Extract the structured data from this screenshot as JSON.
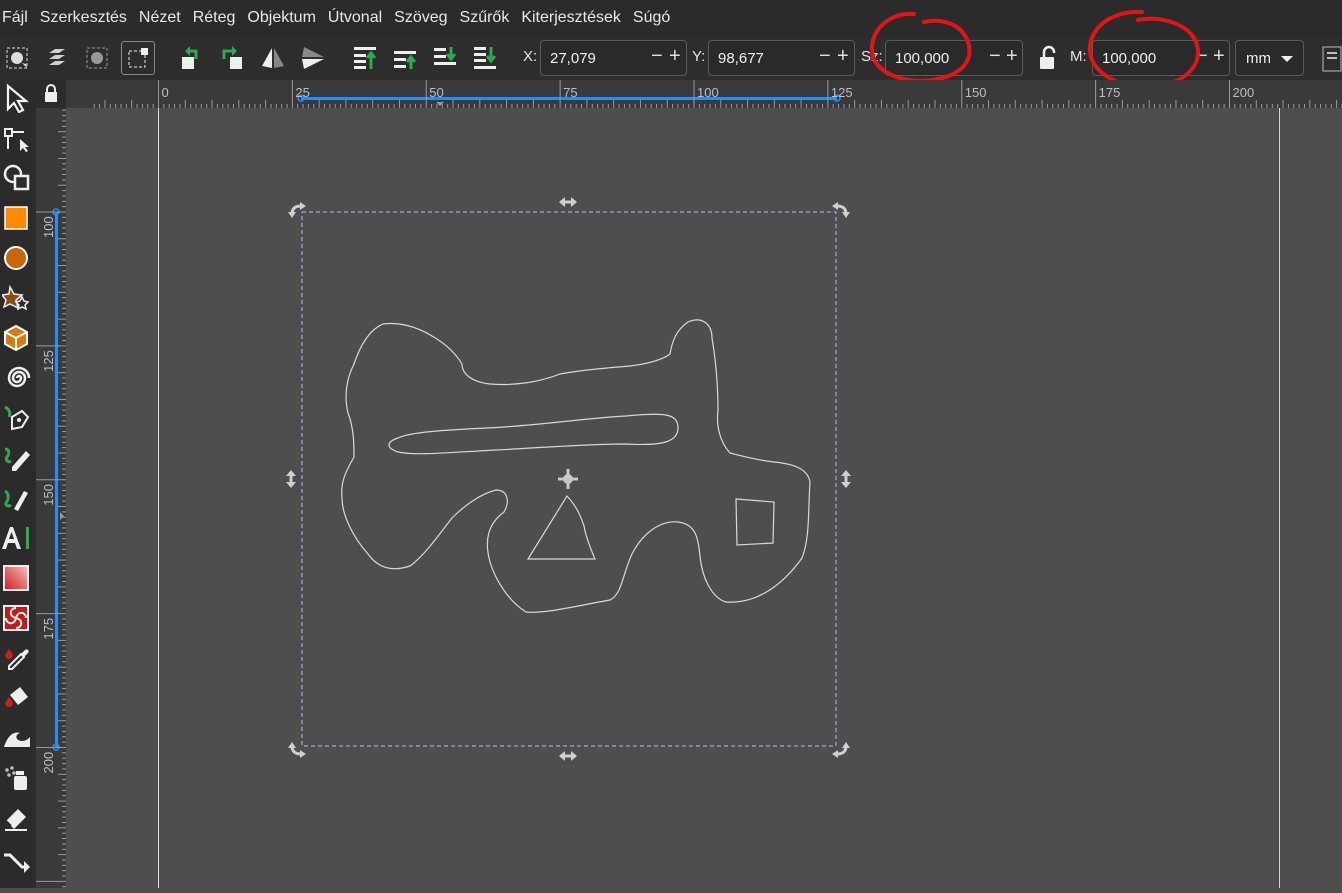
{
  "menu": {
    "file": "Fájl",
    "edit": "Szerkesztés",
    "view": "Nézet",
    "layer": "Réteg",
    "object": "Objektum",
    "path": "Útvonal",
    "text": "Szöveg",
    "filters": "Szűrők",
    "extensions": "Kiterjesztések",
    "help": "Súgó"
  },
  "toolbar": {
    "x_label": "X:",
    "x_value": "27,079",
    "y_label": "Y:",
    "y_value": "98,677",
    "w_label": "Sz:",
    "w_value": "100,000",
    "h_label": "M:",
    "h_value": "100,000",
    "unit": "mm",
    "minus": "−",
    "plus": "+"
  },
  "rulers": {
    "horizontal": [
      "0",
      "25",
      "50",
      "75",
      "100",
      "125",
      "150",
      "175",
      "200"
    ],
    "vertical": [
      "100",
      "125",
      "150",
      "175",
      "200"
    ]
  },
  "colors": {
    "accent_blue": "#1e90ff",
    "annotation_red": "#e01616",
    "rect_tool_orange": "#ff8a00",
    "ellipse_tool_orange": "#c8670a",
    "path_outline": "#d9d9d9",
    "selection_dash": "#b9b1ff"
  },
  "icons": {
    "selector": "arrow-pointer-icon",
    "node": "node-editor-icon",
    "lock": "lock-icon",
    "center": "rotation-center-icon"
  }
}
